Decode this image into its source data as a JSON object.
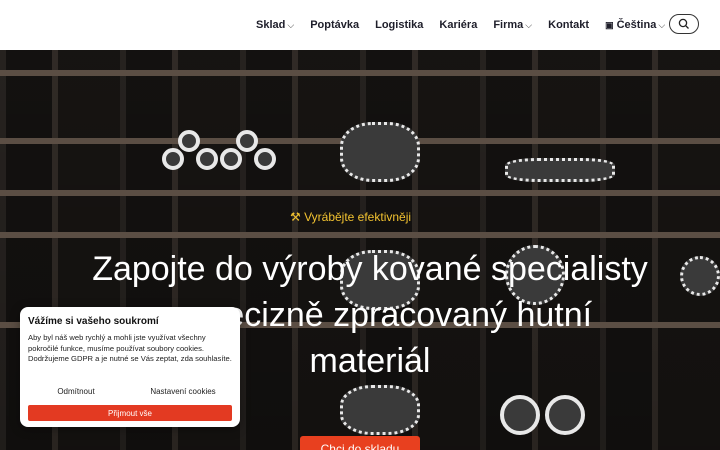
{
  "nav": {
    "items": [
      {
        "label": "Sklad",
        "dropdown": true
      },
      {
        "label": "Poptávka",
        "dropdown": false
      },
      {
        "label": "Logistika",
        "dropdown": false
      },
      {
        "label": "Kariéra",
        "dropdown": false
      },
      {
        "label": "Firma",
        "dropdown": true
      },
      {
        "label": "Kontakt",
        "dropdown": false
      }
    ],
    "language": "Čeština",
    "search_icon": "search-icon"
  },
  "hero": {
    "tagline": "Vyrábějte efektivněji",
    "headline": "Zapojte do výroby kované specialisty na precizně zpracovaný hutní materiál",
    "cta_label": "Chci do skladu"
  },
  "cookie": {
    "title": "Vážíme si vašeho soukromí",
    "text": "Aby byl náš web rychlý a mohli jste využívat všechny pokročilé funkce, musíme používat soubory cookies. Dodržujeme GDPR a je nutné se Vás zeptat, zda souhlasíte.",
    "deny_label": "Odmítnout",
    "settings_label": "Nastavení cookies",
    "accept_label": "Přijmout vše"
  },
  "colors": {
    "accent": "#e8401f",
    "tagline": "#f2c230"
  }
}
